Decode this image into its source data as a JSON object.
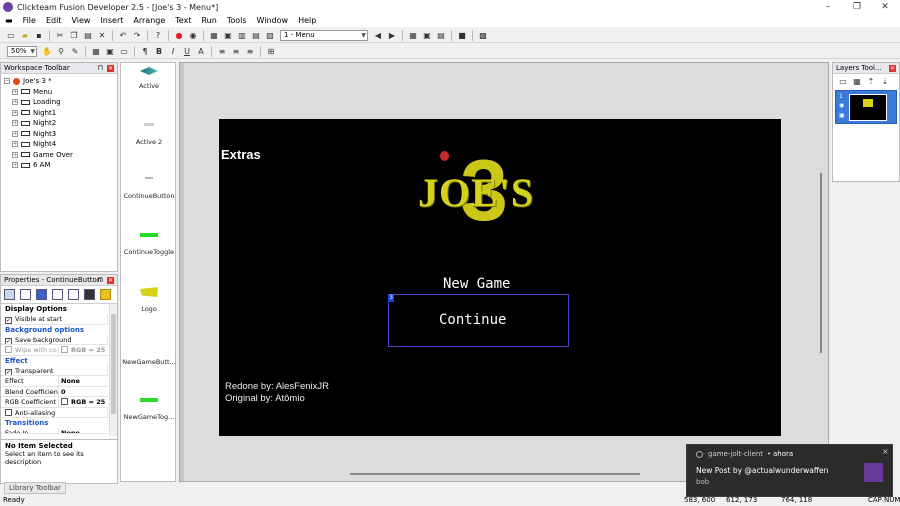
{
  "window": {
    "title": "Clickteam Fusion Developer 2.5 - [Joe's 3 - Menu*]",
    "controls": [
      "–",
      "❐",
      "✕"
    ]
  },
  "menu": [
    "File",
    "Edit",
    "View",
    "Insert",
    "Arrange",
    "Text",
    "Run",
    "Tools",
    "Window",
    "Help"
  ],
  "toolbar": {
    "frame_select": "1 - Menu",
    "zoom": "50%"
  },
  "workspace": {
    "title": "Workspace Toolbar",
    "root": "Joe's 3 *",
    "frames": [
      "Menu",
      "Loading",
      "Night1",
      "Night2",
      "Night3",
      "Night4",
      "Game Over",
      "6 AM"
    ]
  },
  "properties": {
    "title": "Properties - ContinueButton",
    "display_options": "Display Options",
    "visible_at_start": "Visible at start",
    "background_options": "Background options",
    "save_background": "Save background",
    "wipe_with": "Wipe with co",
    "wipe_value": "RGB = 25",
    "effect_section": "Effect",
    "transparent": "Transparent",
    "effect_label": "Effect",
    "effect_value": "None",
    "blend_label": "Blend Coefficient",
    "blend_value": "0",
    "rgb_label": "RGB Coefficient",
    "rgb_value": "RGB = 25",
    "anti_aliasing": "Anti-aliasing",
    "transitions": "Transitions",
    "fade_in": "Fade In",
    "fade_in_value": "None",
    "no_item": "No Item Selected",
    "no_item_desc": "Select an item to see its description"
  },
  "objects": [
    "Active",
    "Active 2",
    "ContinueButton",
    "ContinueToggle",
    "Logo",
    "NewGameButt...",
    "NewGameTog..."
  ],
  "frame": {
    "extras": "Extras",
    "logo_text": "JOE'S",
    "logo_number": "3",
    "new_game": "New Game",
    "continue": "Continue",
    "selection_index": "3",
    "credit1": "Redone by: AlesFenixJR",
    "credit2": "Original by: Atômio"
  },
  "layers": {
    "title": "Layers Tool...",
    "layer_number": "1"
  },
  "library": {
    "label": "Library Toolbar"
  },
  "status": {
    "ready": "Ready",
    "coord1": "583, 600",
    "coord2": "612, 173",
    "coord3": "764, 118",
    "caps": "CAP",
    "num": "NUM"
  },
  "notification": {
    "app": "game-jolt-client",
    "time": "ahora",
    "title": "New Post by @actualwunderwaffen",
    "body": "bob"
  },
  "colors": {
    "accent_blue": "#1a55c8",
    "logo_yellow": "#d6d21a",
    "frame_bg": "#000000",
    "selection": "#5040c0",
    "toggle_green": "#22dd22"
  }
}
